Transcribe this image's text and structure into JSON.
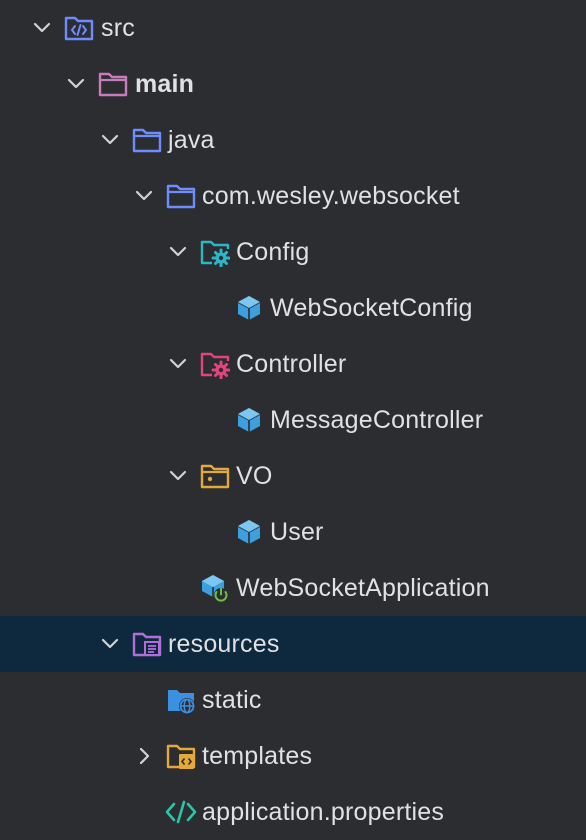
{
  "tree": {
    "src": "src",
    "main": "main",
    "java": "java",
    "package": "com.wesley.websocket",
    "config_folder": "Config",
    "websocket_config": "WebSocketConfig",
    "controller_folder": "Controller",
    "message_controller": "MessageController",
    "vo_folder": "VO",
    "user": "User",
    "application": "WebSocketApplication",
    "resources": "resources",
    "static": "static",
    "templates": "templates",
    "properties": "application.properties"
  },
  "colors": {
    "background": "#2b2d30",
    "selected_row": "#0e283e",
    "text": "#dfe1e5",
    "folder_blue": "#6f8cff",
    "folder_purple": "#c77dbb",
    "folder_teal": "#2bb8c6",
    "folder_red": "#e0457b",
    "folder_orange": "#e5a939",
    "class_blue": "#3d9fe0"
  },
  "icons": {
    "chevron_expanded": "chevron-down-icon",
    "chevron_collapsed": "chevron-right-icon",
    "source_root": "source-root-folder-icon",
    "folder": "folder-icon",
    "config_package": "config-folder-icon",
    "controller_package": "controller-folder-icon",
    "vo_package": "vo-folder-icon",
    "class": "java-class-icon",
    "spring_app": "spring-boot-application-icon",
    "resources_root": "resources-root-folder-icon",
    "web_folder": "web-folder-icon",
    "templates_folder": "templates-folder-icon",
    "properties": "properties-file-icon"
  }
}
